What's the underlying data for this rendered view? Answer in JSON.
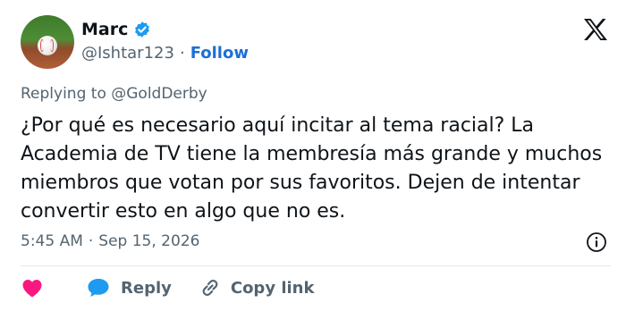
{
  "author": {
    "display_name": "Marc",
    "handle": "@Ishtar123",
    "separator": "·",
    "follow_label": "Follow",
    "verified": true
  },
  "tweet": {
    "replying_to": "Replying to @GoldDerby",
    "text": "¿Por qué es necesario aquí incitar al tema racial? La Academia de TV tiene la membresía más grande y muchos miembros que votan por sus favoritos. Dejen de intentar convertir esto en algo que no es.",
    "time": "5:45 AM",
    "meta_separator": "·",
    "date": "Sep 15, 2026"
  },
  "actions": {
    "reply_label": "Reply",
    "copy_link_label": "Copy link"
  },
  "icons": {
    "verified": "verified-badge-icon",
    "x_logo": "x-logo-icon",
    "info": "info-icon",
    "heart": "heart-icon",
    "reply": "speech-bubble-icon",
    "link": "link-icon"
  },
  "colors": {
    "accent": "#1d6fd8",
    "heart": "#f91880",
    "verified": "#1d9bf0",
    "muted": "#536471",
    "text": "#0f1419"
  }
}
